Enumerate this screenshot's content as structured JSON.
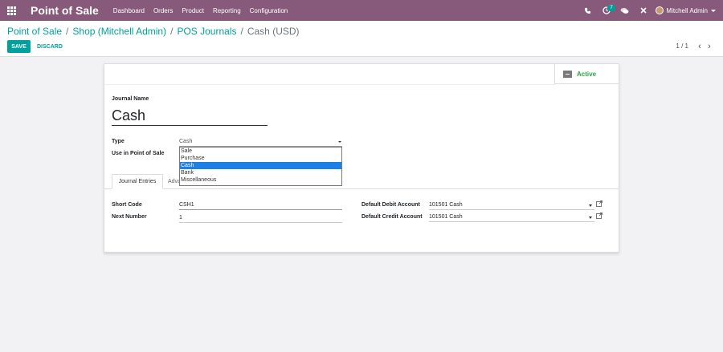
{
  "navbar": {
    "app_name": "Point of Sale",
    "menu": [
      "Dashboard",
      "Orders",
      "Product",
      "Reporting",
      "Configuration"
    ],
    "activity_count": "7",
    "user_name": "Mitchell Admin",
    "colors": {
      "brand": "#875a7b",
      "accent": "#00a09d"
    }
  },
  "breadcrumb": {
    "items": [
      "Point of Sale",
      "Shop (Mitchell Admin)",
      "POS Journals"
    ],
    "current": "Cash (USD)"
  },
  "actions": {
    "save": "SAVE",
    "discard": "DISCARD"
  },
  "pager": {
    "value": "1 / 1",
    "prev": "‹",
    "next": "›"
  },
  "form": {
    "status_button": "Active",
    "journal_name_label": "Journal Name",
    "journal_name": "Cash",
    "type_label": "Type",
    "type_value": "Cash",
    "type_options": [
      "Sale",
      "Purchase",
      "Cash",
      "Bank",
      "Miscellaneous"
    ],
    "type_selected": "Cash",
    "use_pos_label": "Use in Point of Sale",
    "tabs": [
      "Journal Entries",
      "Advanced Settings"
    ],
    "short_code_label": "Short Code",
    "short_code": "CSH1",
    "next_number_label": "Next Number",
    "next_number": "1",
    "debit_label": "Default Debit Account",
    "debit_value": "101501 Cash",
    "credit_label": "Default Credit Account",
    "credit_value": "101501 Cash"
  }
}
